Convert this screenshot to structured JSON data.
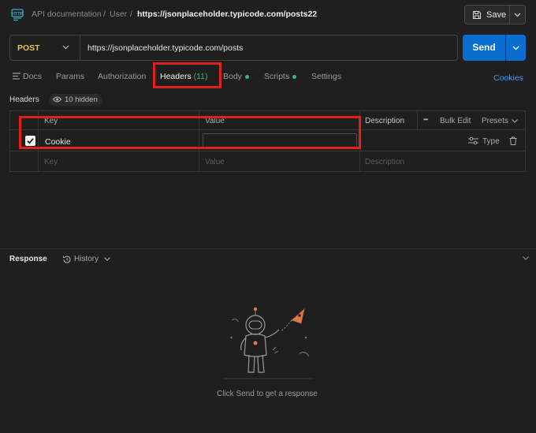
{
  "breadcrumb": {
    "items": [
      "API documentation",
      "User"
    ],
    "separator": "/",
    "current": "https://jsonplaceholder.typicode.com/posts22"
  },
  "toolbar": {
    "save_label": "Save"
  },
  "request": {
    "method": "POST",
    "url": "https://jsonplaceholder.typicode.com/posts",
    "send_label": "Send"
  },
  "tabs": {
    "docs": "Docs",
    "params": "Params",
    "authorization": "Authorization",
    "headers": "Headers",
    "headers_count": "(11)",
    "body": "Body",
    "scripts": "Scripts",
    "settings": "Settings"
  },
  "cookies_link": "Cookies",
  "headers_section": {
    "title": "Headers",
    "hidden_label": "10 hidden"
  },
  "table": {
    "columns": {
      "key": "Key",
      "value": "Value",
      "description": "Description"
    },
    "actions": {
      "more": "•••",
      "bulk_edit": "Bulk Edit",
      "presets": "Presets"
    },
    "rows": [
      {
        "checked": true,
        "key": "Cookie",
        "value": "",
        "description": "",
        "type_label": "Type"
      }
    ],
    "placeholder": {
      "key": "Key",
      "value": "Value",
      "description": "Description"
    }
  },
  "response": {
    "title": "Response",
    "history_label": "History",
    "empty_message": "Click Send to get a response"
  },
  "colors": {
    "accent": "#0a6ed1",
    "method": "#e8c34a",
    "status_dot": "#2fbf68",
    "highlight": "#e0201c",
    "link": "#3b9cf3"
  }
}
